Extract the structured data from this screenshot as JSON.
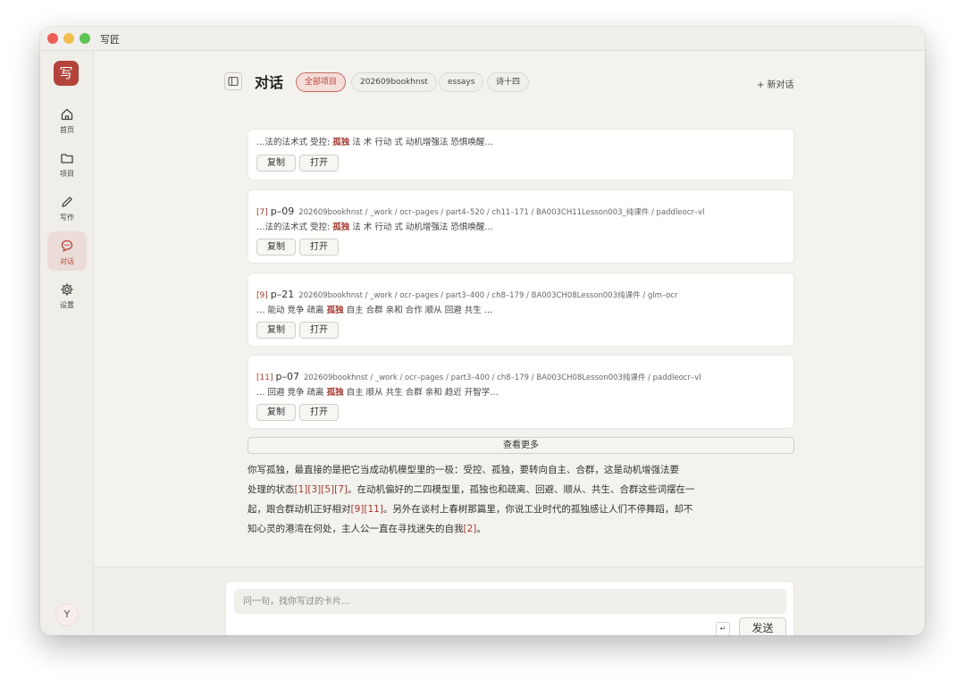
{
  "window": {
    "app_title": "写匠"
  },
  "sidebar": {
    "logo": "写",
    "items": [
      {
        "label": "首页",
        "icon": "home-icon"
      },
      {
        "label": "项目",
        "icon": "folder-icon"
      },
      {
        "label": "写作",
        "icon": "pencil-icon"
      },
      {
        "label": "对话",
        "icon": "chat-icon",
        "active": true
      },
      {
        "label": "设置",
        "icon": "gear-icon"
      }
    ],
    "avatar": "Y"
  },
  "header": {
    "title": "对话",
    "chips": [
      "全部项目",
      "202609bookhnst",
      "essays",
      "诗十四"
    ],
    "active_chip": "全部项目",
    "new_chat": "+ 新对话"
  },
  "cards": [
    {
      "ref": "",
      "page": "",
      "path": "",
      "snippet_parts": [
        "…法的法术式  受控: ",
        "孤独",
        "  法 术 行动 式  动机增强法 恐惧唤醒…"
      ],
      "copy": "复制",
      "open": "打开"
    },
    {
      "ref": "[7]",
      "page": "p–09",
      "path": "202609bookhnst / _work / ocr–pages / part4–520 / ch11–171 / BA003CH11Lesson003_纯课件 / paddleocr–vl",
      "snippet_parts": [
        "…法的法术式  受控: ",
        "孤独",
        "  法 术 行动 式  动机增强法 恐惧唤醒…"
      ],
      "copy": "复制",
      "open": "打开"
    },
    {
      "ref": "[9]",
      "page": "p–21",
      "path": "202609bookhnst / _work / ocr–pages / part3–400 / ch8–179 / BA003CH08Lesson003纯课件 / glm–ocr",
      "snippet_parts": [
        "… 能动 竞争 疏离 ",
        "孤独",
        " 自主 合群 亲和 合作 顺从 回避 共生 …"
      ],
      "copy": "复制",
      "open": "打开"
    },
    {
      "ref": "[11]",
      "page": "p–07",
      "path": "202609bookhnst / _work / ocr–pages / part3–400 / ch8–179 / BA003CH08Lesson003纯课件 / paddleocr–vl",
      "snippet_parts": [
        "… 回避 竞争 疏离 ",
        "孤独",
        " 自主 顺从 共生 合群 亲和 趋近 开智学…"
      ],
      "copy": "复制",
      "open": "打开"
    }
  ],
  "see_more": "查看更多",
  "answer": {
    "line1": "你写孤独，最直接的是把它当成动机模型里的一极：受控、孤独，要转向自主、合群，这是动机增强法要",
    "line2_pre": "处理的状态",
    "line2_refs": "[1][3][5][7]",
    "line2_post": "。在动机偏好的二四模型里，孤独也和疏离、回避、顺从、共生、合群这些词摆在一",
    "line3_pre": "起，跟合群动机正好相对",
    "line3_refs": "[9][11]",
    "line3_post": "。另外在谈村上春树那篇里，你说工业时代的孤独感让人们不停舞蹈，却不",
    "line4_pre": "知心灵的港湾在何处，主人公一直在寻找迷失的自我",
    "line4_refs": "[2]",
    "line4_post": "。"
  },
  "composer": {
    "placeholder": "问一句，找你写过的卡片…",
    "enter_hint": "↵",
    "send": "发送"
  },
  "colors": {
    "accent": "#b3443b",
    "highlight": "#a33a31",
    "background": "#f4f2ee"
  }
}
